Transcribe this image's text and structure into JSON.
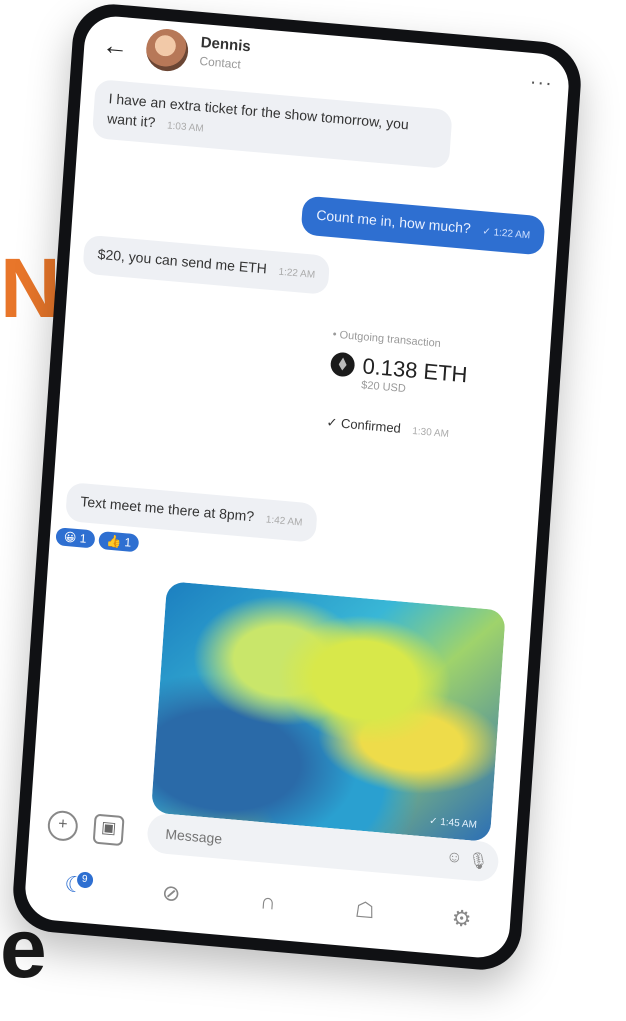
{
  "background": {
    "glyph_1": "N",
    "glyph_2": "e",
    "accent": "#e8762a"
  },
  "header": {
    "back_icon": "←",
    "contact_name": "Dennis",
    "contact_status": "Contact",
    "more_icon": "···"
  },
  "messages": [
    {
      "text": "I have an extra ticket for the show tomorrow, you want it?",
      "time": "1:03 AM",
      "direction": "incoming"
    },
    {
      "text": "Count me in, how much?",
      "time": "✓ 1:22 AM",
      "direction": "outgoing"
    },
    {
      "text": "$20, you can send me ETH",
      "time": "1:22 AM",
      "direction": "incoming"
    },
    {
      "text": "Text meet me there at 8pm?",
      "time": "1:42 AM",
      "direction": "incoming"
    }
  ],
  "transaction": {
    "label": "• Outgoing transaction",
    "amount": "0.138 ETH",
    "usd": "$20 USD",
    "status": "✓ Confirmed",
    "time": "1:30 AM"
  },
  "reactions": [
    "😀 1",
    "👍 1"
  ],
  "photo": {
    "time": "✓ 1:45 AM"
  },
  "composer": {
    "placeholder": "Message",
    "add_icon": "+",
    "gallery_icon": "▣",
    "emoji_icon": "☺",
    "mic_icon": "🎙"
  },
  "nav": {
    "chats_badge": "9",
    "chats_icon": "☾",
    "compass_icon": "⊘",
    "shop_icon": "∩",
    "wallet_icon": "☖",
    "settings_icon": "⚙"
  },
  "colors": {
    "outgoing_bubble": "#2e6fd1",
    "incoming_bubble": "#eef0f4"
  }
}
